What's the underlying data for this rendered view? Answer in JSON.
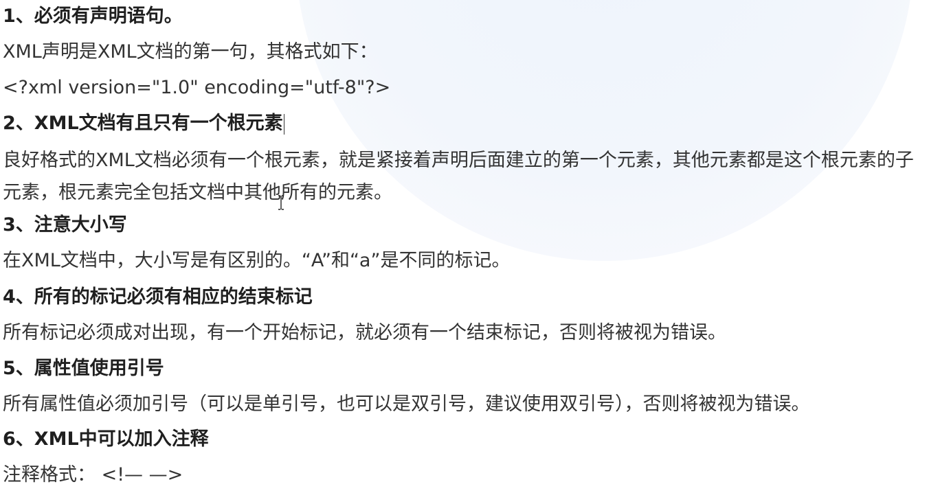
{
  "sections": [
    {
      "heading": "1、必须有声明语句。",
      "lines": [
        "XML声明是XML文档的第一句，其格式如下：",
        "<?xml version=\"1.0\" encoding=\"utf-8\"?>"
      ]
    },
    {
      "heading": "2、XML文档有且只有一个根元素",
      "lines": [
        "良好格式的XML文档必须有一个根元素，就是紧接着声明后面建立的第一个元素，其他元素都是这个根元素的子元素，根元素完全包括文档中其他所有的元素。"
      ]
    },
    {
      "heading": "3、注意大小写",
      "lines": [
        "在XML文档中，大小写是有区别的。“A”和“a”是不同的标记。"
      ]
    },
    {
      "heading": "4、所有的标记必须有相应的结束标记",
      "lines": [
        "所有标记必须成对出现，有一个开始标记，就必须有一个结束标记，否则将被视为错误。"
      ]
    },
    {
      "heading": "5、属性值使用引号",
      "lines": [
        "所有属性值必须加引号（可以是单引号，也可以是双引号，建议使用双引号），否则将被视为错误。"
      ]
    },
    {
      "heading": "6、XML中可以加入注释",
      "lines": [
        "注释格式： <!— —>"
      ]
    }
  ]
}
